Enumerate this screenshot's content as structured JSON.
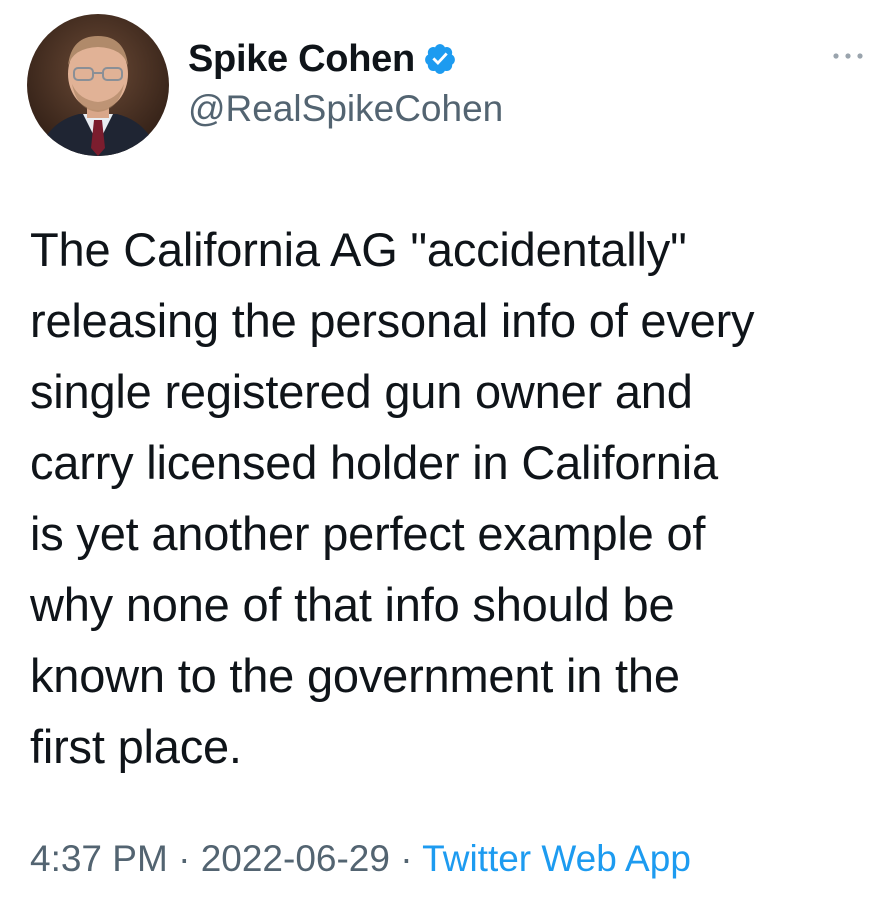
{
  "author": {
    "display_name": "Spike Cohen",
    "handle": "@RealSpikeCohen",
    "verified": true,
    "avatar_icon": "profile-photo"
  },
  "tweet": {
    "text": "The California AG \"accidentally\"\nreleasing the personal info of every\nsingle registered gun owner and\ncarry licensed holder in California\nis yet another perfect example of\nwhy none of that info should be\nknown to the government in the\nfirst place."
  },
  "meta": {
    "time": "4:37 PM",
    "separator1": " · ",
    "date": "2022-06-29",
    "separator2": " · ",
    "source": "Twitter Web App"
  },
  "colors": {
    "text": "#0f1419",
    "secondary": "#536471",
    "accent": "#1d9bf0"
  },
  "icons": {
    "verified": "verified-badge-icon",
    "more": "more-options-icon"
  }
}
